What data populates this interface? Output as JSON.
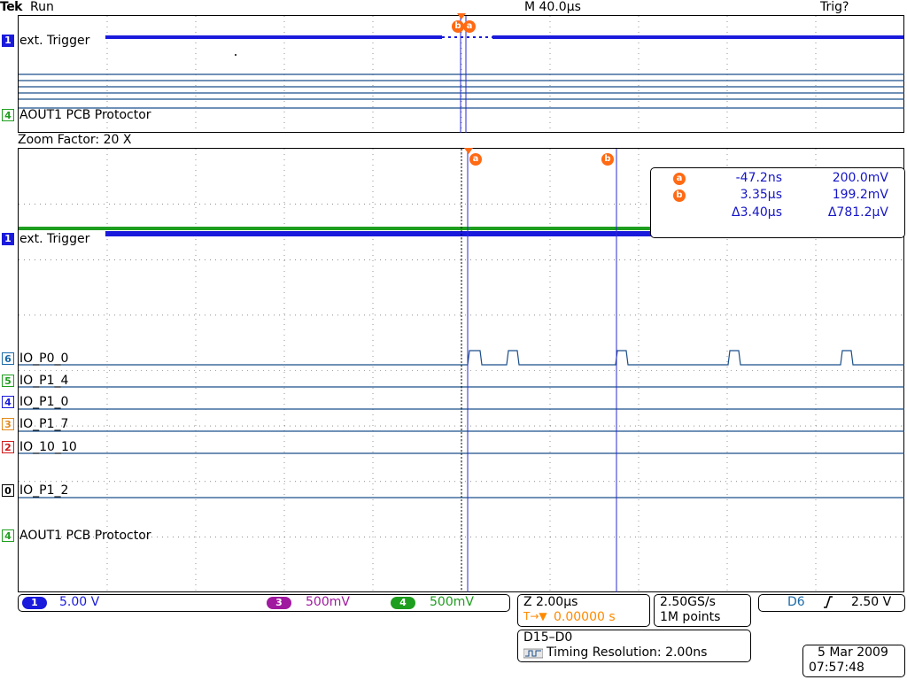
{
  "status_bar": {
    "brand": "Tek",
    "acq_state": "Run",
    "timebase": "M 40.0µs",
    "trigger_state": "Trig?"
  },
  "overview": {
    "ch1_label": "ext. Trigger",
    "ch4_label": "AOUT1 PCB Protoctor",
    "ch1_marker": "1",
    "ch4_marker": "4",
    "cursor_b_label": "b",
    "cursor_a_label": "a"
  },
  "zoom": {
    "zoom_factor": "Zoom Factor: 20 X",
    "cursor_a_label": "a",
    "cursor_b_label": "b",
    "analog": [
      {
        "marker": "1",
        "label": "ext. Trigger",
        "color": "#1a1adc"
      },
      {
        "marker": "4",
        "label": "AOUT1 PCB Protoctor",
        "color": "#1e9e1e"
      }
    ],
    "digital": [
      {
        "marker": "6",
        "label": "IO_P0_0",
        "color": "#1b6aa8"
      },
      {
        "marker": "5",
        "label": "IO_P1_4",
        "color": "#1e9e1e"
      },
      {
        "marker": "4",
        "label": "IO_P1_0",
        "color": "#1a1adc"
      },
      {
        "marker": "3",
        "label": "IO_P1_7",
        "color": "#e08a1a"
      },
      {
        "marker": "2",
        "label": "IO_10_10",
        "color": "#d11a1a"
      },
      {
        "marker": "0",
        "label": "IO_P1_2",
        "color": "#000000"
      }
    ]
  },
  "cursor_readout": {
    "a_label": "a",
    "b_label": "b",
    "a_time": "-47.2ns",
    "a_volt": "200.0mV",
    "b_time": "3.35µs",
    "b_volt": "199.2mV",
    "delta_time": "Δ3.40µs",
    "delta_volt": "Δ781.2µV"
  },
  "vertical": {
    "ch1_chip": "1",
    "ch1_scale": "5.00 V",
    "ch3_chip": "3",
    "ch3_scale": "500mV",
    "ch4_chip": "4",
    "ch4_scale": "500mV"
  },
  "horizontal": {
    "zoom_scale": "Z 2.00µs",
    "trigger_icon": "T→▼",
    "position": "0.00000 s",
    "sample_rate": "2.50GS/s",
    "record_length": "1M points"
  },
  "trigger": {
    "source": "D6",
    "slope_icon": "rising-edge-icon",
    "level": "2.50 V"
  },
  "digital_info": {
    "bus": "D15–D0",
    "timing": "Timing Resolution: 2.00ns"
  },
  "datetime": {
    "date": "5 Mar  2009",
    "time": "07:57:48"
  },
  "colors": {
    "ch1": "#1a1adc",
    "ch3": "#a01aa0",
    "ch4": "#1e9e1e",
    "cursor": "#ff6a13",
    "cursor_line": "#2a2ad0"
  }
}
